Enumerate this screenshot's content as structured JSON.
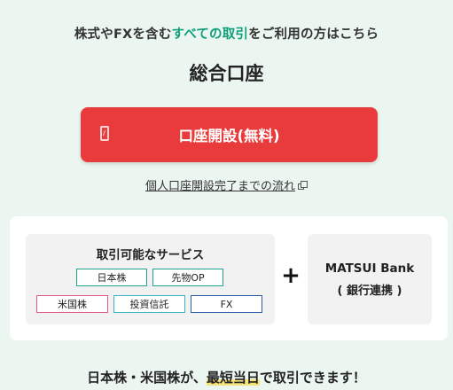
{
  "intro": {
    "prefix": "株式やFXを含む",
    "highlight": "すべての取引",
    "suffix": "をご利用の方はこちら"
  },
  "account_type": "総合口座",
  "open_account_button": {
    "label": "口座開設(無料)",
    "icon": "smartphone-icon"
  },
  "flow_link": {
    "label": "個人口座開設完了までの流れ",
    "icon": "external-link-icon"
  },
  "services": {
    "title": "取引可能なサービス",
    "tags": [
      "日本株",
      "先物OP",
      "米国株",
      "投資信託",
      "FX"
    ]
  },
  "plus_sign": "+",
  "bank": {
    "name": "MATSUI Bank",
    "note": "( 銀行連携 )"
  },
  "tagline": {
    "prefix": "日本株・米国株が、",
    "highlight": "最短当日",
    "suffix": "で取引できます！"
  },
  "colors": {
    "accent_green": "#0f9e7a",
    "cta_red": "#e93b3b",
    "background": "#ecf6f1",
    "highlight_yellow": "#f6e27a"
  }
}
